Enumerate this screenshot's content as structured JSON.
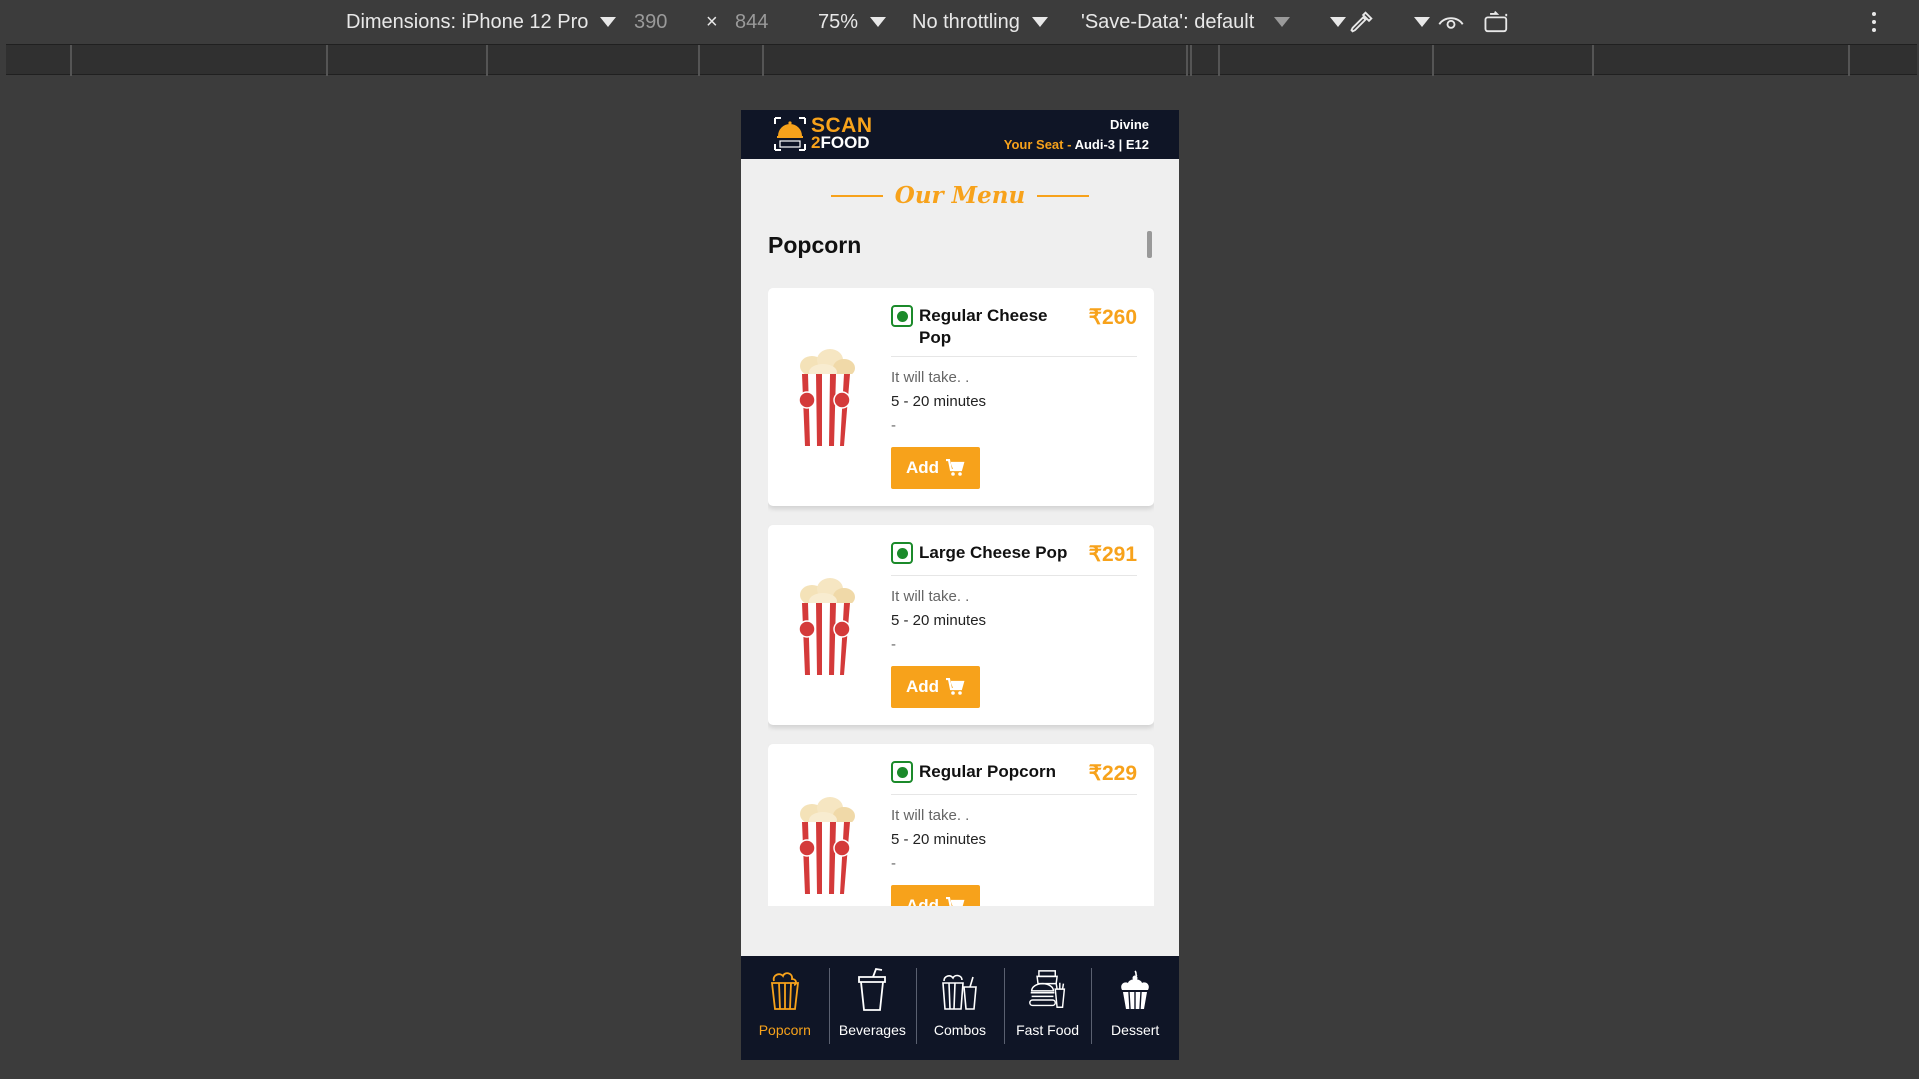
{
  "devtools": {
    "dimensions_label": "Dimensions: iPhone 12 Pro",
    "width": "390",
    "times": "×",
    "height": "844",
    "zoom": "75%",
    "throttling": "No throttling",
    "save_data": "'Save-Data': default",
    "icons": [
      "caret-down-icon",
      "eyedropper-icon",
      "eye-icon",
      "rotate-icon",
      "more-vert-icon"
    ]
  },
  "header": {
    "logo_line1": "SCAN",
    "logo_line2_num": "2",
    "logo_line2_word": "FOOD",
    "theatre": "Divine",
    "seat_label": "Your Seat - ",
    "seat_value": "Audi-3 | E12"
  },
  "menu_title": "Our Menu",
  "category_heading": "Popcorn",
  "items": [
    {
      "name": "Regular Cheese Pop",
      "price": "₹260",
      "take_label": "It will take. .",
      "time": "5 - 20 minutes",
      "extra": "-",
      "add_label": "Add"
    },
    {
      "name": "Large Cheese Pop",
      "price": "₹291",
      "take_label": "It will take. .",
      "time": "5 - 20 minutes",
      "extra": "-",
      "add_label": "Add"
    },
    {
      "name": "Regular Popcorn",
      "price": "₹229",
      "take_label": "It will take. .",
      "time": "5 - 20 minutes",
      "extra": "-",
      "add_label": "Add"
    }
  ],
  "nav": [
    {
      "label": "Popcorn",
      "icon": "popcorn-icon",
      "active": true
    },
    {
      "label": "Beverages",
      "icon": "cup-icon",
      "active": false
    },
    {
      "label": "Combos",
      "icon": "combo-icon",
      "active": false
    },
    {
      "label": "Fast Food",
      "icon": "burger-icon",
      "active": false
    },
    {
      "label": "Dessert",
      "icon": "cupcake-icon",
      "active": false
    }
  ],
  "colors": {
    "accent": "#f7a21b",
    "header_bg": "#0f1526",
    "veg_green": "#1b8a2a",
    "page_bg": "#efefef"
  }
}
